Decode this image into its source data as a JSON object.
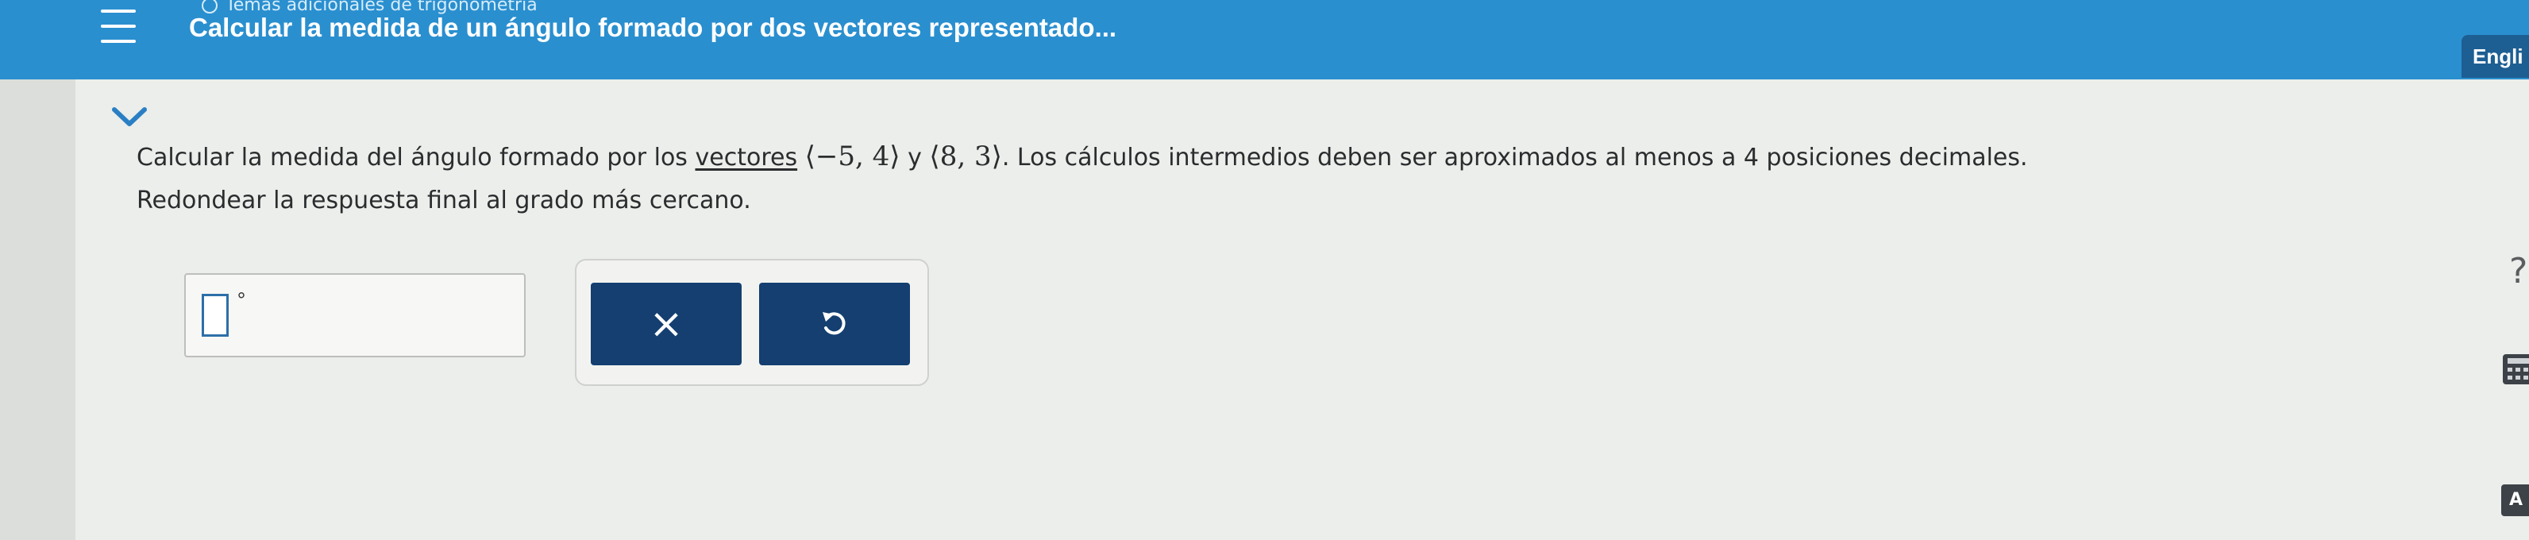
{
  "header": {
    "breadcrumb": "Temas adicionales de trigonometría",
    "title": "Calcular la medida de un ángulo formado por dos vectores representado...",
    "language_button": "Engli"
  },
  "question": {
    "prefix": "Calcular la medida del ángulo formado por los",
    "link_text": "vectores",
    "vector1_x": "−5",
    "vector1_y": "4",
    "conjunction": "y",
    "vector2_x": "8",
    "vector2_y": "3",
    "suffix": ". Los cálculos intermedios deben ser aproximados al menos a 4 posiciones decimales.",
    "instruction": "Redondear la respuesta final al grado más cercano."
  },
  "answer": {
    "value": "",
    "unit_symbol": "°"
  },
  "buttons": {
    "clear_symbol": "×"
  },
  "side_tools": {
    "help_symbol": "?",
    "text_symbol": "A"
  },
  "colors": {
    "header_blue": "#2a8fcf",
    "button_navy": "#143f70",
    "page_bg": "#eceeeb"
  },
  "icons": [
    "menu-icon",
    "chevron-down-icon",
    "close-icon",
    "undo-icon",
    "help-icon",
    "calculator-icon",
    "text-size-icon"
  ]
}
